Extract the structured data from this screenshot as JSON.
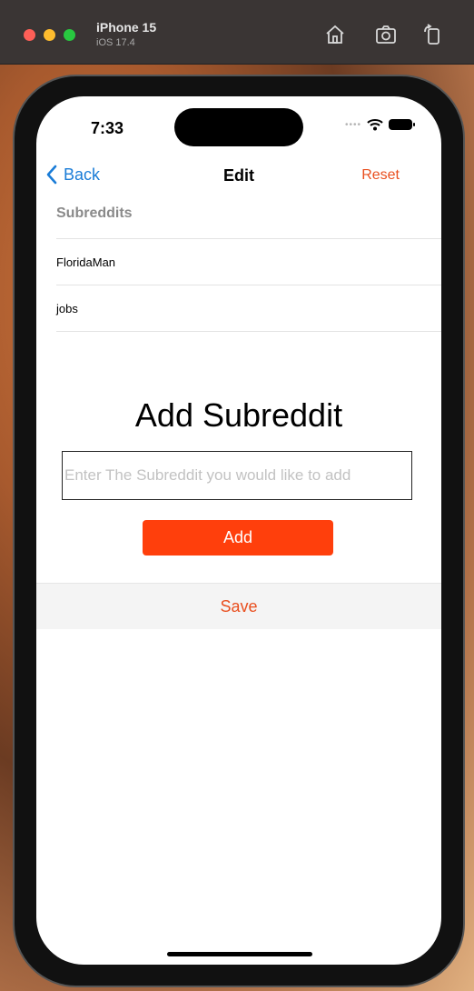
{
  "simulator": {
    "device_name": "iPhone 15",
    "os_version": "iOS 17.4",
    "tools": [
      "home-icon",
      "screenshot-icon",
      "rotate-icon"
    ]
  },
  "status_bar": {
    "time": "7:33"
  },
  "nav": {
    "back_label": "Back",
    "title": "Edit",
    "reset_label": "Reset"
  },
  "subreddits": {
    "header": "Subreddits",
    "items": [
      "FloridaMan",
      "jobs"
    ]
  },
  "add_section": {
    "title": "Add Subreddit",
    "input_placeholder": "Enter The Subreddit you would like to add",
    "input_value": "",
    "add_button_label": "Add"
  },
  "save_label": "Save",
  "colors": {
    "accent_orange": "#ff3f0c",
    "link_blue": "#1a7cd7",
    "action_orange_text": "#e94f1f"
  }
}
